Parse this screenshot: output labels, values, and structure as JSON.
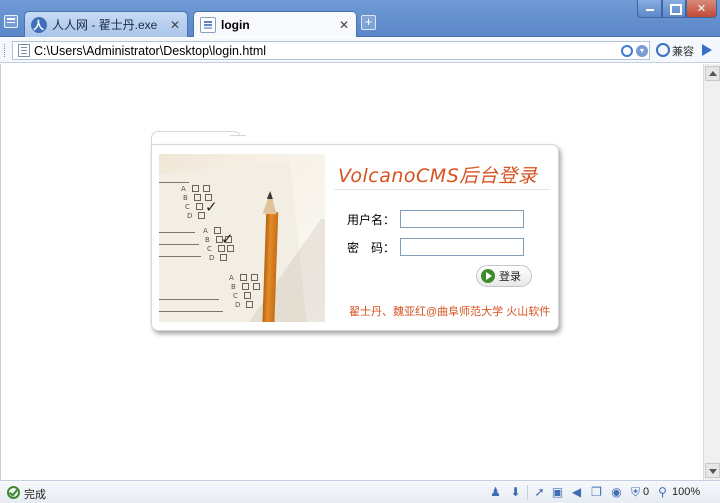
{
  "tabs": [
    {
      "label": "人人网 - 翟士丹.exe",
      "active": false
    },
    {
      "label": "login",
      "active": true
    }
  ],
  "address": {
    "url": "C:\\Users\\Administrator\\Desktop\\login.html",
    "compat_label": "兼容"
  },
  "login": {
    "title": "VolcanoCMS后台登录",
    "username_label": "用户名：",
    "password_label": "密　码：",
    "username_value": "",
    "password_value": "",
    "submit_label": "登录",
    "credit": "翟士丹、魏亚红@曲阜师范大学  火山软件",
    "accent_color": "#d7521f"
  },
  "photo": {
    "letters": [
      "A",
      "B",
      "C",
      "D"
    ]
  },
  "status": {
    "text": "完成",
    "blocked_count": "0",
    "zoom": "100%"
  },
  "icons": {
    "status_left": "check-circle-icon",
    "status_right": [
      "person-icon",
      "download-icon",
      "cursor-icon",
      "lock-icon",
      "speaker-icon",
      "window-icon",
      "eye-icon",
      "shield-icon",
      "zoom-icon"
    ]
  }
}
